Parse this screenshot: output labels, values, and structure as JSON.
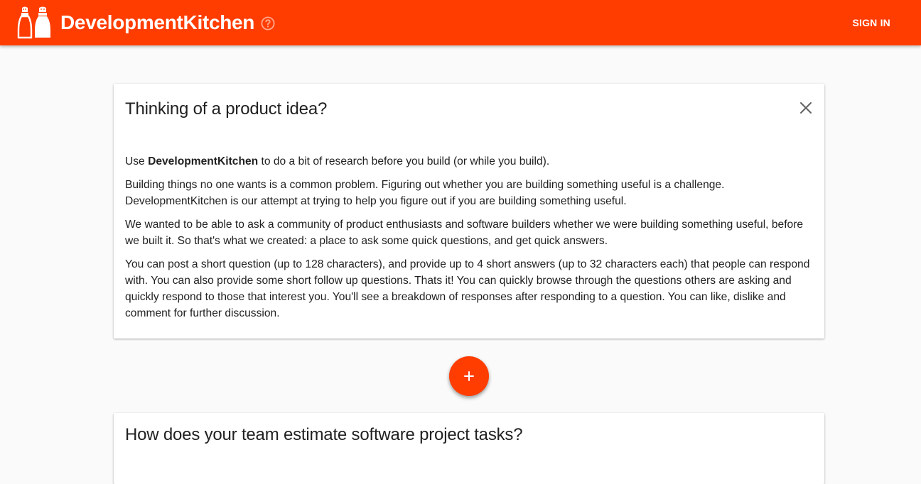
{
  "app": {
    "brand": "DevelopmentKitchen",
    "help_icon": "help-circle-icon",
    "logo_icon": "salt-pepper-shakers-icon",
    "signin_label": "SIGN IN",
    "accent_color": "#ff3d00"
  },
  "intro": {
    "title": "Thinking of a product idea?",
    "close_icon": "close-icon",
    "p1_prefix": "Use ",
    "p1_brand": "DevelopmentKitchen",
    "p1_suffix": " to do a bit of research before you build (or while you build).",
    "p2": "Building things no one wants is a common problem. Figuring out whether you are building something useful is a challenge. DevelopmentKitchen is our attempt at trying to help you figure out if you are building something useful.",
    "p3": "We wanted to be able to ask a community of product enthusiasts and software builders whether we were building something useful, before we built it. So that's what we created: a place to ask some quick questions, and get quick answers.",
    "p4": "You can post a short question (up to 128 characters), and provide up to 4 short answers (up to 32 characters each) that people can respond with. You can also provide some short follow up questions. Thats it! You can quickly browse through the questions others are asking and quickly respond to those that interest you. You'll see a breakdown of responses after responding to a question. You can like, dislike and comment for further discussion."
  },
  "fab": {
    "icon": "plus-icon"
  },
  "questions": [
    {
      "title": "How does your team estimate software project tasks?"
    }
  ]
}
